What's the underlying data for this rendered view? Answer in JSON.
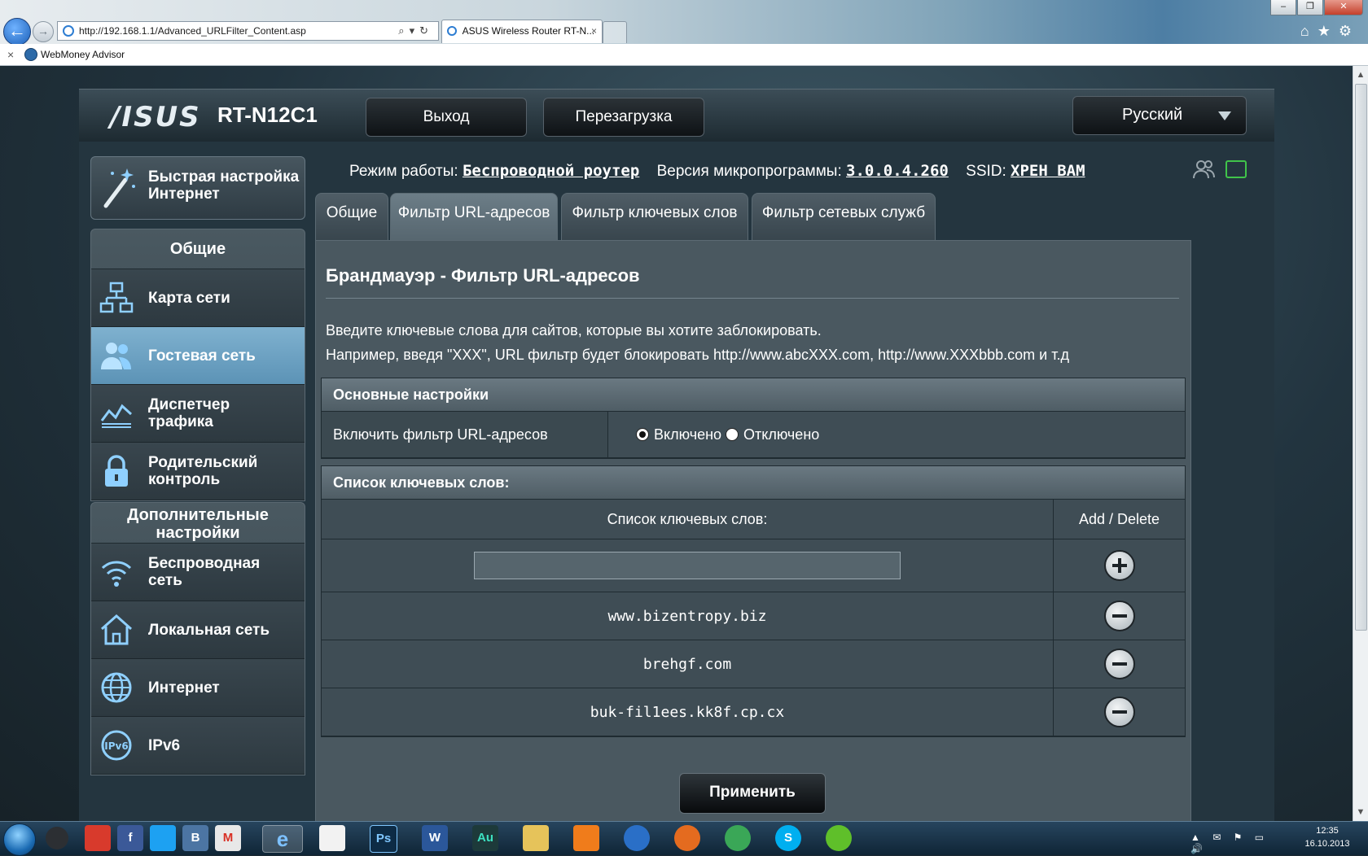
{
  "browser": {
    "url": "http://192.168.1.1/Advanced_URLFilter_Content.asp",
    "tab_title": "ASUS Wireless Router RT-N...",
    "tab_close": "×",
    "fav_close": "×",
    "favorites_item": "WebMoney Advisor",
    "window_buttons": [
      "–",
      "❐",
      "✕"
    ]
  },
  "router": {
    "brand": "/ISUS",
    "model": "RT-N12C1",
    "logout_label": "Выход",
    "reboot_label": "Перезагрузка",
    "language": "Русский",
    "info": {
      "mode_label": "Режим работы:",
      "mode_value": "Беспроводной роутер",
      "firmware_label": "Версия микропрограммы:",
      "firmware_value": "3.0.0.4.260",
      "ssid_label": "SSID:",
      "ssid_value": "ХРЕН ВАМ"
    }
  },
  "sidebar": {
    "quick_setup_line1": "Быстрая настройка",
    "quick_setup_line2": "Интернет",
    "general_title": "Общие",
    "general_items": [
      {
        "l1": "Карта сети",
        "l2": "",
        "icon": "network-map-icon"
      },
      {
        "l1": "Гостевая сеть",
        "l2": "",
        "icon": "guest-network-icon"
      },
      {
        "l1": "Диспетчер",
        "l2": "трафика",
        "icon": "traffic-manager-icon"
      },
      {
        "l1": "Родительский",
        "l2": "контроль",
        "icon": "parental-control-icon"
      }
    ],
    "advanced_title_line1": "Дополнительные",
    "advanced_title_line2": "настройки",
    "advanced_items": [
      {
        "l1": "Беспроводная",
        "l2": "сеть",
        "icon": "wireless-icon"
      },
      {
        "l1": "Локальная сеть",
        "l2": "",
        "icon": "lan-home-icon"
      },
      {
        "l1": "Интернет",
        "l2": "",
        "icon": "internet-globe-icon"
      },
      {
        "l1": "IPv6",
        "l2": "",
        "icon": "ipv6-icon"
      }
    ]
  },
  "tabs": [
    "Общие",
    "Фильтр URL-адресов",
    "Фильтр ключевых слов",
    "Фильтр сетевых служб"
  ],
  "content": {
    "title": "Брандмауэр - Фильтр URL-адресов",
    "desc1": "Введите ключевые слова для сайтов, которые вы хотите заблокировать.",
    "desc2": "Например, введя \"XXX\", URL фильтр будет блокировать http://www.abcXXX.com, http://www.XXXbbb.com и т.д",
    "basic": {
      "header": "Основные настройки",
      "enable_label": "Включить фильтр URL-адресов",
      "on_label": "Включено",
      "off_label": "Отключено"
    },
    "list": {
      "header": "Список ключевых слов:",
      "col_keyword": "Список ключевых слов:",
      "col_action": "Add / Delete",
      "input_value": "",
      "entries": [
        "www.bizentropy.biz",
        "brehgf.com",
        "buk-fil1ees.kk8f.cp.cx"
      ]
    },
    "apply_label": "Применить"
  },
  "taskbar": {
    "time": "12:35",
    "date": "16.10.2013",
    "apps": [
      "Angry Birds",
      "f",
      "Twitter",
      "B",
      "Gmail",
      "Internet Explorer",
      "Picasa",
      "Ps",
      "W",
      "Au",
      "Explorer",
      "Media",
      "iTunes",
      "Firefox",
      "Chrome",
      "Skype",
      "ICQ"
    ]
  },
  "colors": {
    "accent_active": "#6fa3c4",
    "usb_icon": "#40c44a"
  }
}
